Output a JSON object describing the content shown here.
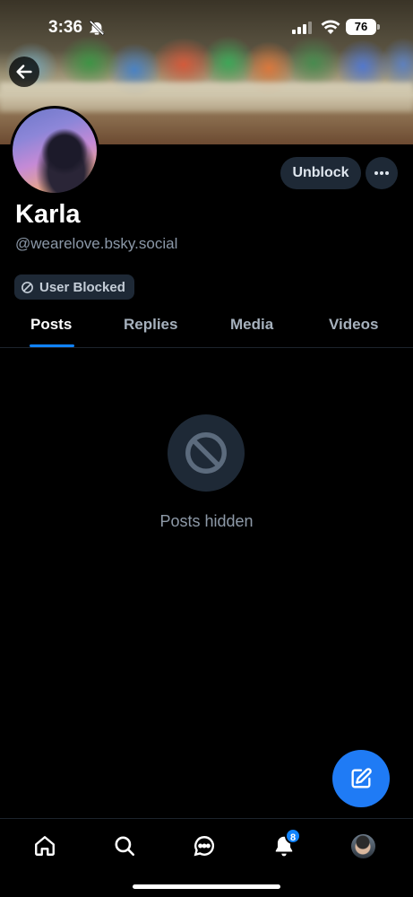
{
  "status_bar": {
    "time": "3:36",
    "battery": "76"
  },
  "profile": {
    "display_name": "Karla",
    "handle": "@wearelove.bsky.social",
    "unblock_label": "Unblock",
    "blocked_label": "User Blocked"
  },
  "tabs": [
    {
      "label": "Posts",
      "active": true
    },
    {
      "label": "Replies",
      "active": false
    },
    {
      "label": "Media",
      "active": false
    },
    {
      "label": "Videos",
      "active": false
    }
  ],
  "empty_state": {
    "message": "Posts hidden",
    "icon": "ban-icon"
  },
  "bottom_nav": {
    "items": [
      "home-icon",
      "search-icon",
      "chat-icon",
      "bell-icon",
      "profile-avatar"
    ],
    "notification_count": "8"
  },
  "colors": {
    "accent": "#1083fe",
    "fab": "#1f7bf5",
    "pill_bg": "#1e2936",
    "muted_text": "#8b98a8"
  }
}
